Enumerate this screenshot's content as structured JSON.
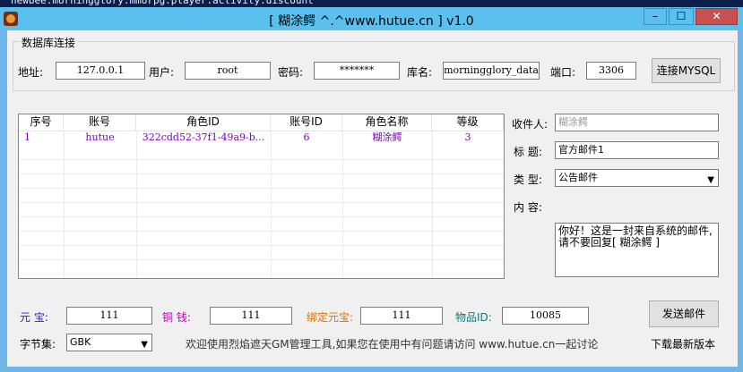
{
  "background_text": "newbee.morningglory.mmorpg.player.activity.discount",
  "window": {
    "title": "[ 糊涂鳄  ^.^www.hutue.cn ] v1.0",
    "min": "–",
    "max": "☐",
    "close": "✕"
  },
  "db": {
    "group_title": "数据库连接",
    "addr_label": "地址:",
    "addr": "127.0.0.1",
    "user_label": "用户:",
    "user": "root",
    "pwd_label": "密码:",
    "pwd": "*******",
    "dbname_label": "库名:",
    "dbname": "morningglory_data",
    "port_label": "端口:",
    "port": "3306",
    "connect_btn": "连接MYSQL"
  },
  "table": {
    "headers": [
      "序号",
      "账号",
      "角色ID",
      "账号ID",
      "角色名称",
      "等级"
    ],
    "rows": [
      [
        "1",
        "hutue",
        "322cdd52-37f1-49a9-b...",
        "6",
        "糊涂鳄",
        "3"
      ]
    ]
  },
  "mail": {
    "recipient_label": "收件人:",
    "recipient_placeholder": "糊涂鳄",
    "title_label": "标  题:",
    "title_value": "官方邮件1",
    "type_label": "类  型:",
    "type_value": "公告邮件",
    "content_label": "内  容:",
    "content_value": "你好！这是一封来自系统的邮件,请不要回复[ 糊涂鳄 ]",
    "send_btn": "发送邮件"
  },
  "bottom": {
    "yuanbao_label": "元  宝:",
    "yuanbao": "111",
    "tongqian_label": "铜  钱:",
    "tongqian": "111",
    "bind_label": "绑定元宝:",
    "bind": "111",
    "itemid_label": "物品ID:",
    "itemid": "10085",
    "charset_label": "字节集:",
    "charset": "GBK",
    "welcome": "欢迎使用烈焰遮天GM管理工具,如果您在使用中有问题请访问 www.hutue.cn一起讨论",
    "download": "下载最新版本"
  },
  "colors": {
    "yuanbao": "#2020d0",
    "tongqian": "#c000c0",
    "bind": "#e07000",
    "itemid": "#008080"
  }
}
